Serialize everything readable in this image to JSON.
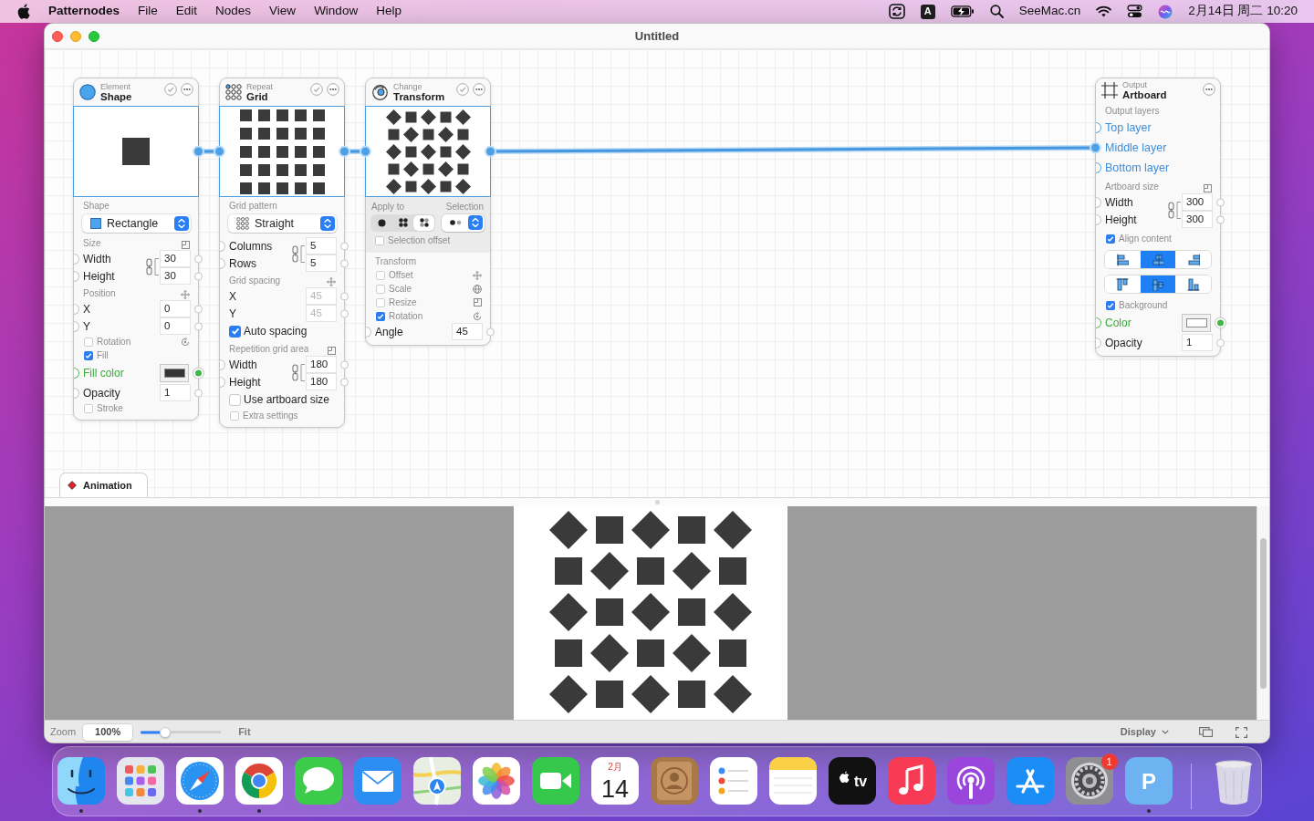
{
  "menu_bar": {
    "app_name": "Patternodes",
    "menus": [
      "File",
      "Edit",
      "Nodes",
      "View",
      "Window",
      "Help"
    ],
    "input_source": "A",
    "account": "SeeMac.cn",
    "clock": "2月14日 周二 10:20"
  },
  "window": {
    "title": "Untitled"
  },
  "nodes": [
    {
      "kind": "shape",
      "category": "Element",
      "title": "Shape",
      "output_connected": true,
      "rows": [
        {
          "kind": "section",
          "label": "Shape"
        },
        {
          "kind": "select",
          "value": "Rectangle"
        },
        {
          "kind": "section",
          "label": "Size"
        },
        {
          "kind": "pair",
          "fields": [
            {
              "label": "Width",
              "value": "30"
            },
            {
              "label": "Height",
              "value": "30"
            }
          ]
        },
        {
          "kind": "section",
          "label": "Position"
        },
        {
          "kind": "field",
          "label": "X",
          "value": "0",
          "disabled": false
        },
        {
          "kind": "field",
          "label": "Y",
          "value": "0",
          "disabled": false
        },
        {
          "kind": "option",
          "label": "Rotation",
          "checked": false
        },
        {
          "kind": "option",
          "label": "Fill",
          "checked": true
        },
        {
          "kind": "color",
          "label": "Fill color",
          "color": "#353535"
        },
        {
          "kind": "field",
          "label": "Opacity",
          "value": "1",
          "disabled": false
        },
        {
          "kind": "option",
          "label": "Stroke",
          "checked": false
        }
      ]
    },
    {
      "kind": "grid",
      "category": "Repeat",
      "title": "Grid",
      "input_connected": true,
      "output_connected": true,
      "rows": [
        {
          "kind": "section",
          "label": "Grid pattern"
        },
        {
          "kind": "select",
          "value": "Straight"
        },
        {
          "kind": "pair",
          "fields": [
            {
              "label": "Columns",
              "value": "5"
            },
            {
              "label": "Rows",
              "value": "5"
            }
          ]
        },
        {
          "kind": "section",
          "label": "Grid spacing"
        },
        {
          "kind": "field",
          "label": "X",
          "value": "45",
          "disabled": true
        },
        {
          "kind": "field",
          "label": "Y",
          "value": "45",
          "disabled": true
        },
        {
          "kind": "checkbox",
          "label": "Auto spacing",
          "checked": true
        },
        {
          "kind": "section",
          "label": "Repetition grid area"
        },
        {
          "kind": "pair",
          "fields": [
            {
              "label": "Width",
              "value": "180"
            },
            {
              "label": "Height",
              "value": "180"
            }
          ]
        },
        {
          "kind": "checkbox",
          "label": "Use artboard size",
          "checked": false
        },
        {
          "kind": "option",
          "label": "Extra settings",
          "checked": false
        }
      ]
    },
    {
      "kind": "transform",
      "category": "Change",
      "title": "Transform",
      "input_connected": true,
      "output_connected": true,
      "rows": [
        {
          "kind": "apply",
          "labels": [
            "Apply to",
            "Selection"
          ],
          "segments": [
            {
              "selected": false
            },
            {
              "selected": false
            },
            {
              "selected": true
            }
          ],
          "offset": {
            "label": "Selection offset",
            "checked": false
          }
        },
        {
          "kind": "section",
          "label": "Transform"
        },
        {
          "kind": "option",
          "label": "Offset",
          "checked": false
        },
        {
          "kind": "option",
          "label": "Scale",
          "checked": false
        },
        {
          "kind": "option",
          "label": "Resize",
          "checked": false
        },
        {
          "kind": "option",
          "label": "Rotation",
          "checked": true
        },
        {
          "kind": "field",
          "label": "Angle",
          "value": "45",
          "disabled": false
        }
      ]
    },
    {
      "kind": "artboard",
      "category": "Output",
      "title": "Artboard",
      "rows": [
        {
          "kind": "section",
          "label": "Output layers"
        },
        {
          "kind": "layer",
          "label": "Top layer",
          "connected": false
        },
        {
          "kind": "layer",
          "label": "Middle layer",
          "connected": true
        },
        {
          "kind": "layer",
          "label": "Bottom layer",
          "connected": false
        },
        {
          "kind": "section",
          "label": "Artboard size"
        },
        {
          "kind": "pair",
          "fields": [
            {
              "label": "Width",
              "value": "300"
            },
            {
              "label": "Height",
              "value": "300"
            }
          ]
        },
        {
          "kind": "option",
          "label": "Align content",
          "checked": true
        },
        {
          "kind": "halign",
          "options": [
            {
              "selected": false
            },
            {
              "selected": true
            },
            {
              "selected": false
            }
          ]
        },
        {
          "kind": "valign",
          "options": [
            {
              "selected": false
            },
            {
              "selected": true
            },
            {
              "selected": false
            }
          ]
        },
        {
          "kind": "option",
          "label": "Background",
          "checked": true
        },
        {
          "kind": "color",
          "label": "Color",
          "color": "#ffffff"
        },
        {
          "kind": "field",
          "label": "Opacity",
          "value": "1",
          "disabled": false
        }
      ]
    }
  ],
  "animation_tab": {
    "label": "Animation"
  },
  "bottom_bar": {
    "zoom_label": "Zoom",
    "zoom_value": "100%",
    "zoom_slider": {
      "level": 0.3
    },
    "fit_button": "Fit",
    "display_button": "Display"
  },
  "dock": {
    "items": [
      {
        "kind": "finder",
        "running": true
      },
      {
        "kind": "launchpad",
        "running": false
      },
      {
        "kind": "safari",
        "running": true
      },
      {
        "kind": "chrome",
        "running": true
      },
      {
        "kind": "messages",
        "running": false
      },
      {
        "kind": "mail",
        "running": false
      },
      {
        "kind": "maps",
        "running": false
      },
      {
        "kind": "photos",
        "running": false
      },
      {
        "kind": "facetime",
        "running": false
      },
      {
        "kind": "calendar",
        "running": false,
        "month": "2月",
        "day": "14"
      },
      {
        "kind": "contacts",
        "running": false
      },
      {
        "kind": "reminders",
        "running": false
      },
      {
        "kind": "notes",
        "running": false
      },
      {
        "kind": "tv",
        "running": false,
        "label": "tv"
      },
      {
        "kind": "music",
        "running": false
      },
      {
        "kind": "podcasts",
        "running": false
      },
      {
        "kind": "appstore",
        "running": false
      },
      {
        "kind": "settings",
        "running": false,
        "badge": "1"
      },
      {
        "kind": "app",
        "running": true,
        "label": "P"
      },
      {
        "kind": "trash",
        "running": false
      }
    ]
  }
}
